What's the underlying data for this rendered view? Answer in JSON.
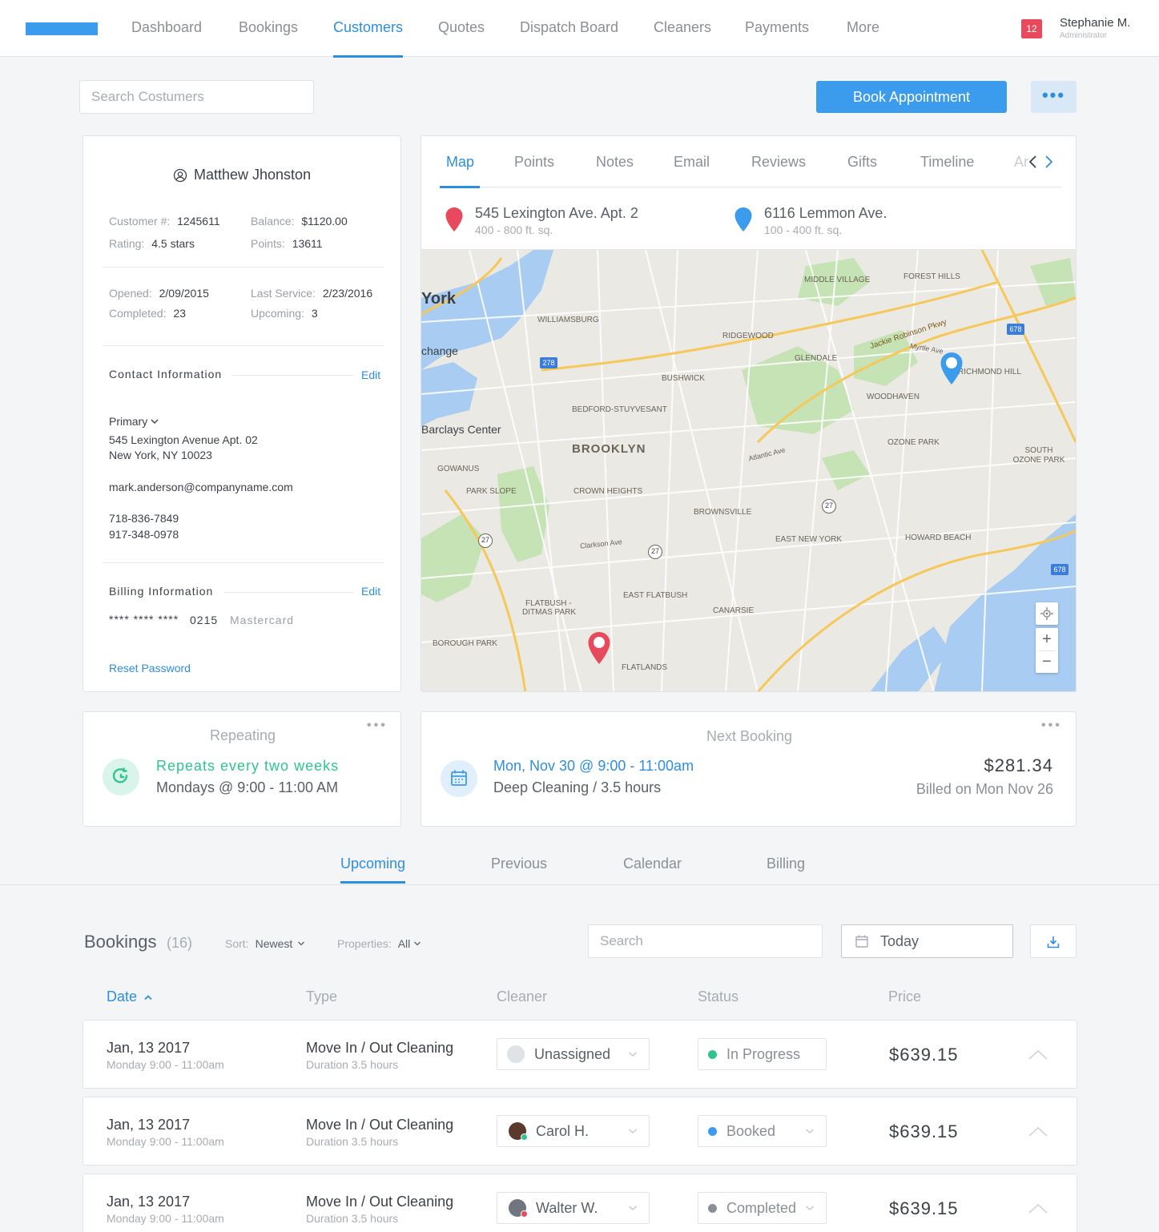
{
  "nav": {
    "items": [
      "Dashboard",
      "Bookings",
      "Customers",
      "Quotes",
      "Dispatch Board",
      "Cleaners",
      "Payments",
      "More"
    ],
    "active": "Customers",
    "notifications": "12",
    "user_name": "Stephanie M.",
    "user_role": "Administrator"
  },
  "header": {
    "search_placeholder": "Search Costumers",
    "book_label": "Book Appointment",
    "more_label": "•••"
  },
  "customer": {
    "name": "Matthew Jhonston",
    "customer_no_label": "Customer #:",
    "customer_no": "1245611",
    "balance_label": "Balance:",
    "balance": "$1120.00",
    "rating_label": "Rating:",
    "rating": "4.5 stars",
    "points_label": "Points:",
    "points": "13611",
    "opened_label": "Opened:",
    "opened": "2/09/2015",
    "last_service_label": "Last Service:",
    "last_service": "2/23/2016",
    "completed_label": "Completed:",
    "completed": "23",
    "upcoming_label": "Upcoming:",
    "upcoming": "3",
    "contact_title": "Contact Information",
    "edit_label": "Edit",
    "primary_label": "Primary",
    "address1": "545 Lexington Avenue Apt. 02",
    "address2": "New York, NY 10023",
    "email": "mark.anderson@companyname.com",
    "phone1": "718-836-7849",
    "phone2": "917-348-0978",
    "billing_title": "Billing Information",
    "card_mask": "**** **** ****",
    "card_last": "0215",
    "card_type": "Mastercard",
    "reset_label": "Reset Password"
  },
  "map_panel": {
    "tabs": [
      "Map",
      "Points",
      "Notes",
      "Email",
      "Reviews",
      "Gifts",
      "Timeline",
      "Ar"
    ],
    "active": "Map",
    "locations": [
      {
        "address": "545 Lexington Ave. Apt. 2",
        "size": "400 - 800 ft. sq.",
        "color": "#e8495c"
      },
      {
        "address": "6116 Lemmon Ave.",
        "size": "100 - 400 ft. sq.",
        "color": "#3b9bec"
      }
    ],
    "map_labels": {
      "york": "York",
      "exchange": "change",
      "barclays": "Barclays Center",
      "brooklyn": "BROOKLYN",
      "williamsburg": "WILLIAMSBURG",
      "bushwick": "BUSHWICK",
      "bedford": "BEDFORD-STUYVESANT",
      "ridgewood": "RIDGEWOOD",
      "middle_village": "MIDDLE VILLAGE",
      "forest_hills": "FOREST HILLS",
      "glendale": "GLENDALE",
      "woodhaven": "WOODHAVEN",
      "richmond_hill": "RICHMOND HILL",
      "ozone_park": "OZONE PARK",
      "south_ozone": "SOUTH OZONE PARK",
      "gowanus": "GOWANUS",
      "park_slope": "PARK SLOPE",
      "crown_heights": "CROWN HEIGHTS",
      "brownsville": "BROWNSVILLE",
      "east_new_york": "EAST NEW YORK",
      "howard_beach": "HOWARD BEACH",
      "flatbush": "FLATBUSH -",
      "ditmas": "DITMAS PARK",
      "east_flatbush": "EAST FLATBUSH",
      "canarsie": "CANARSIE",
      "borough_park": "BOROUGH PARK",
      "flatlands": "FLATLANDS",
      "jackie": "Jackie Robinson Pkwy",
      "myrtle": "Myrtle Ave",
      "atlantic": "Atlantic Ave",
      "clarkson": "Clarkson Ave",
      "hw278": "278",
      "hw678": "678",
      "hw27": "27"
    },
    "zoom_in": "+",
    "zoom_out": "−"
  },
  "repeating": {
    "title": "Repeating",
    "line1": "Repeats every two weeks",
    "line2": "Mondays @ 9:00 - 11:00 AM"
  },
  "next_booking": {
    "title": "Next Booking",
    "when": "Mon, Nov 30 @ 9:00 - 11:00am",
    "what": "Deep Cleaning / 3.5 hours",
    "amount": "$281.34",
    "billed": "Billed on Mon Nov 26"
  },
  "section_tabs": {
    "items": [
      "Upcoming",
      "Previous",
      "Calendar",
      "Billing"
    ],
    "active": "Upcoming"
  },
  "bookings": {
    "title": "Bookings",
    "count": "(16)",
    "sort_label": "Sort:",
    "sort_value": "Newest",
    "properties_label": "Properties:",
    "properties_value": "All",
    "search_placeholder": "Search",
    "date_filter": "Today",
    "columns": [
      "Date",
      "Type",
      "Cleaner",
      "Status",
      "Price"
    ],
    "rows": [
      {
        "date": "Jan, 13 2017",
        "time": "Monday 9:00 - 11:00am",
        "type": "Move In / Out Cleaning",
        "duration": "Duration 3.5 hours",
        "cleaner": "Unassigned",
        "status": "In Progress",
        "status_color": "#2fc48d",
        "price": "$639.15"
      },
      {
        "date": "Jan, 13 2017",
        "time": "Monday 9:00 - 11:00am",
        "type": "Move In / Out Cleaning",
        "duration": "Duration 3.5 hours",
        "cleaner": "Carol H.",
        "status": "Booked",
        "status_color": "#3b9bec",
        "price": "$639.15"
      },
      {
        "date": "Jan, 13 2017",
        "time": "Monday 9:00 - 11:00am",
        "type": "Move In / Out Cleaning",
        "duration": "Duration 3.5 hours",
        "cleaner": "Walter W.",
        "status": "Completed",
        "status_color": "#8a8f96",
        "price": "$639.15"
      }
    ]
  },
  "colors": {
    "accent": "#2e8ede",
    "button": "#3b9bec",
    "alert": "#e8495c",
    "success": "#2fc48d"
  }
}
